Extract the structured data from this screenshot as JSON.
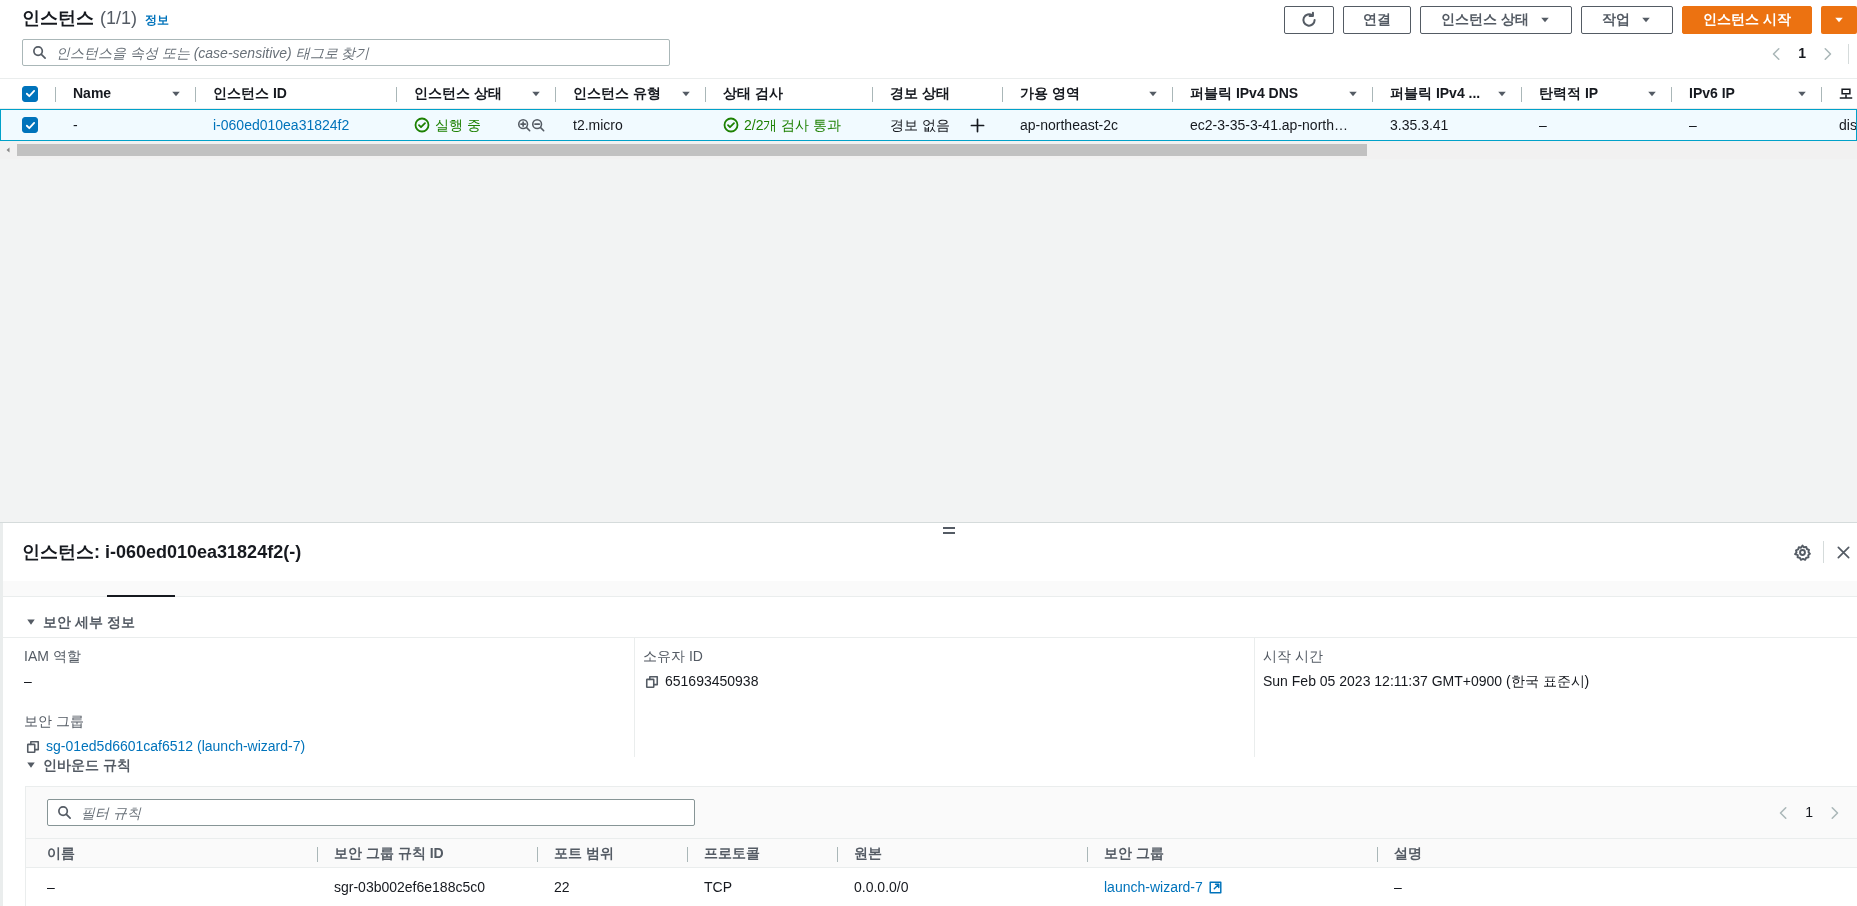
{
  "instances": {
    "title": "인스턴스",
    "count": "(1/1)",
    "info_link": "정보",
    "buttons": [
      {
        "kind": "refresh"
      },
      {
        "kind": "plain",
        "label": "연결"
      },
      {
        "kind": "dropdown",
        "label": "인스턴스 상태"
      },
      {
        "kind": "dropdown",
        "label": "작업"
      },
      {
        "kind": "primary",
        "label": "인스턴스 시작"
      },
      {
        "kind": "primary-caret"
      }
    ],
    "search": {
      "placeholder": "인스턴스을 속성 또는 (case-sensitive) 태그로 찾기"
    },
    "page": "1",
    "table": {
      "all_checked": true,
      "columns": [
        {
          "label": "Name",
          "filter": true
        },
        {
          "label": "인스턴스 ID",
          "filter": false
        },
        {
          "label": "인스턴스 상태",
          "filter": true
        },
        {
          "label": "인스턴스 유형",
          "filter": true
        },
        {
          "label": "상태 검사",
          "filter": false
        },
        {
          "label": "경보 상태",
          "filter": false
        },
        {
          "label": "가용 영역",
          "filter": true
        },
        {
          "label": "퍼블릭 IPv4 DNS",
          "filter": true
        },
        {
          "label": "퍼블릭 IPv4 ...",
          "filter": true
        },
        {
          "label": "탄력적 IP",
          "filter": true
        },
        {
          "label": "IPv6 IP",
          "filter": true
        },
        {
          "label": "모"
        }
      ],
      "rows": [
        {
          "checked": true,
          "selected": true,
          "cells": [
            {
              "kind": "text",
              "text": "-"
            },
            {
              "kind": "link",
              "text": "i-060ed010ea31824f2"
            },
            {
              "kind": "state",
              "text": "실행 중"
            },
            {
              "kind": "text",
              "text": "t2.micro"
            },
            {
              "kind": "check",
              "text": "2/2개 검사 통과"
            },
            {
              "kind": "alarm",
              "text": "경보 없음"
            },
            {
              "kind": "text",
              "text": "ap-northeast-2c"
            },
            {
              "kind": "text",
              "text": "ec2-3-35-3-41.ap-north…"
            },
            {
              "kind": "text",
              "text": "3.35.3.41"
            },
            {
              "kind": "text",
              "text": "–"
            },
            {
              "kind": "text",
              "text": "–"
            },
            {
              "kind": "text",
              "text": "dis"
            }
          ]
        }
      ]
    }
  },
  "details": {
    "title": "인스턴스: i-060ed010ea31824f2(-)",
    "security": {
      "title": "보안 세부 정보",
      "expanded": true,
      "columns": [
        [
          {
            "label": "IAM 역할",
            "kind": "text",
            "value": "–"
          },
          {
            "label": "보안 그룹",
            "kind": "copy-link",
            "value": "sg-01ed5d6601caf6512 (launch-wizard-7)"
          }
        ],
        [
          {
            "label": "소유자 ID",
            "kind": "copy",
            "value": "651693450938"
          }
        ],
        [
          {
            "label": "시작 시간",
            "kind": "text",
            "value": "Sun Feb 05 2023 12:11:37 GMT+0900 (한국 표준시)"
          }
        ]
      ]
    },
    "inbound": {
      "title": "인바운드 규칙",
      "expanded": true,
      "filter_placeholder": "필터 규칙",
      "page": "1",
      "columns": [
        "이름",
        "보안 그룹 규칙 ID",
        "포트 범위",
        "프로토콜",
        "원본",
        "보안 그룹",
        "설명"
      ],
      "rows": [
        [
          {
            "kind": "text",
            "text": "–"
          },
          {
            "kind": "text",
            "text": "sgr-03b002ef6e188c5c0"
          },
          {
            "kind": "text",
            "text": "22"
          },
          {
            "kind": "text",
            "text": "TCP"
          },
          {
            "kind": "text",
            "text": "0.0.0.0/0"
          },
          {
            "kind": "external",
            "text": "launch-wizard-7"
          },
          {
            "kind": "text",
            "text": "–"
          }
        ]
      ]
    }
  }
}
